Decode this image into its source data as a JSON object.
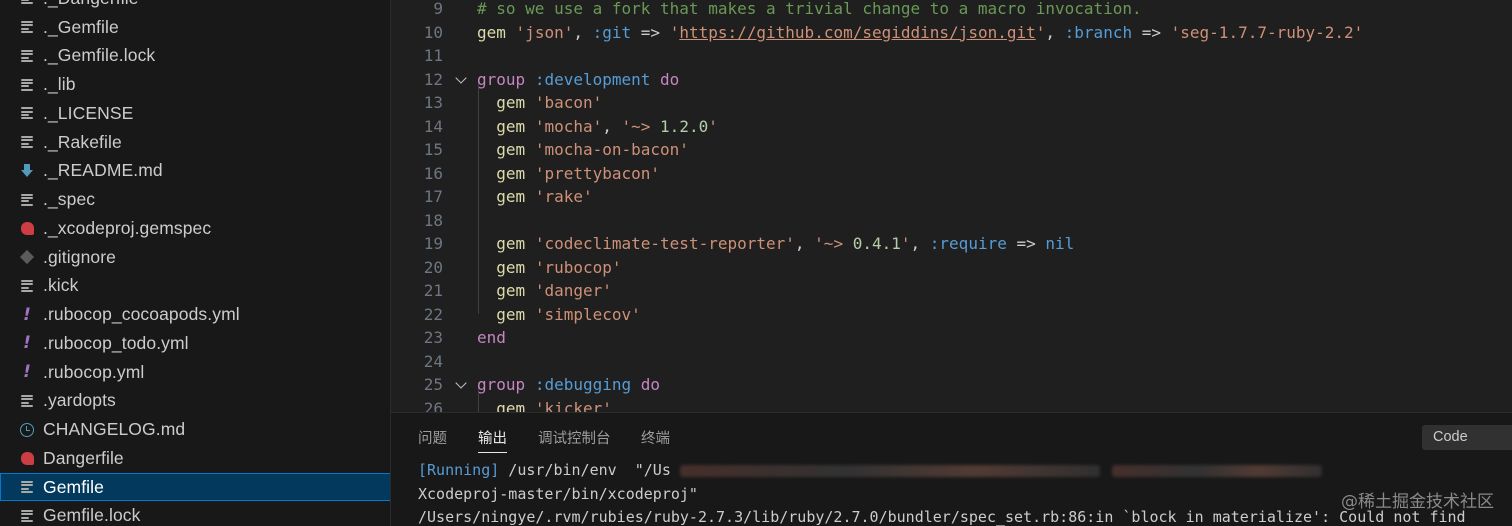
{
  "sidebar": {
    "items": [
      {
        "label": "._Dangerfile",
        "icon": "file-lines-icon"
      },
      {
        "label": "._Gemfile",
        "icon": "file-lines-icon"
      },
      {
        "label": "._Gemfile.lock",
        "icon": "file-lines-icon"
      },
      {
        "label": "._lib",
        "icon": "file-lines-icon"
      },
      {
        "label": "._LICENSE",
        "icon": "file-lines-icon"
      },
      {
        "label": "._Rakefile",
        "icon": "file-lines-icon"
      },
      {
        "label": "._README.md",
        "icon": "markdown-arrow-icon"
      },
      {
        "label": "._spec",
        "icon": "file-lines-icon"
      },
      {
        "label": "._xcodeproj.gemspec",
        "icon": "ruby-icon"
      },
      {
        "label": ".gitignore",
        "icon": "git-icon"
      },
      {
        "label": ".kick",
        "icon": "file-lines-icon"
      },
      {
        "label": ".rubocop_cocoapods.yml",
        "icon": "yaml-exclamation-icon"
      },
      {
        "label": ".rubocop_todo.yml",
        "icon": "yaml-exclamation-icon"
      },
      {
        "label": ".rubocop.yml",
        "icon": "yaml-exclamation-icon"
      },
      {
        "label": ".yardopts",
        "icon": "file-lines-icon"
      },
      {
        "label": "CHANGELOG.md",
        "icon": "changelog-clock-icon"
      },
      {
        "label": "Dangerfile",
        "icon": "ruby-icon"
      },
      {
        "label": "Gemfile",
        "icon": "file-lines-icon",
        "selected": true
      },
      {
        "label": "Gemfile.lock",
        "icon": "file-lines-icon"
      }
    ]
  },
  "editor": {
    "lines": [
      {
        "n": "9",
        "text": "# so we use a fork that makes a trivial change to a macro invocation."
      },
      {
        "n": "10",
        "text": "gem 'json', :git => 'https://github.com/segiddins/json.git', :branch => 'seg-1.7.7-ruby-2.2'"
      },
      {
        "n": "11",
        "text": ""
      },
      {
        "n": "12",
        "text": "group :development do",
        "fold": true
      },
      {
        "n": "13",
        "text": "  gem 'bacon'"
      },
      {
        "n": "14",
        "text": "  gem 'mocha', '~> 1.2.0'"
      },
      {
        "n": "15",
        "text": "  gem 'mocha-on-bacon'"
      },
      {
        "n": "16",
        "text": "  gem 'prettybacon'"
      },
      {
        "n": "17",
        "text": "  gem 'rake'"
      },
      {
        "n": "18",
        "text": ""
      },
      {
        "n": "19",
        "text": "  gem 'codeclimate-test-reporter', '~> 0.4.1', :require => nil"
      },
      {
        "n": "20",
        "text": "  gem 'rubocop'"
      },
      {
        "n": "21",
        "text": "  gem 'danger'"
      },
      {
        "n": "22",
        "text": "  gem 'simplecov'"
      },
      {
        "n": "23",
        "text": "end"
      },
      {
        "n": "24",
        "text": ""
      },
      {
        "n": "25",
        "text": "group :debugging do",
        "fold": true
      },
      {
        "n": "26",
        "text": "  gem 'kicker'"
      }
    ]
  },
  "panel": {
    "tabs": [
      "问题",
      "输出",
      "调试控制台",
      "终端"
    ],
    "active_tab": "输出",
    "channel_select": "Code",
    "output": {
      "line1_running": "[Running]",
      "line1_cmd": " /usr/bin/env",
      "line1_tail": "  \"/Us",
      "line2": "Xcodeproj-master/bin/xcodeproj\"",
      "line3": "/Users/ningye/.rvm/rubies/ruby-2.7.3/lib/ruby/2.7.0/bundler/spec_set.rb:86:in `block in materialize': Could not find"
    },
    "watermark": "@稀土掘金技术社区"
  }
}
